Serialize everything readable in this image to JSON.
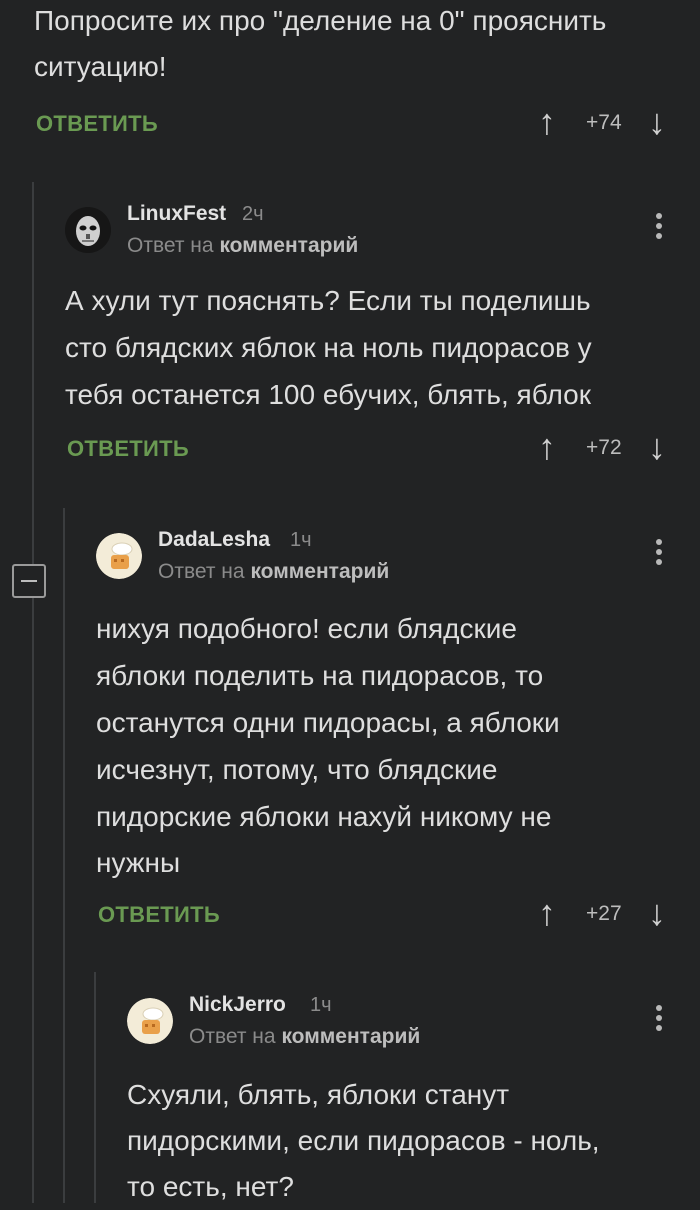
{
  "comment0": {
    "text_line1": "Попросите их про \"деление на 0\" прояснить",
    "text_line2": "ситуацию!",
    "reply_label": "ОТВЕТИТЬ",
    "rating": "+74"
  },
  "comment1": {
    "username": "LinuxFest",
    "time": "2ч",
    "answer_prefix": "Ответ на",
    "answer_target": "комментарий",
    "text_line1": "А хули тут пояснять? Если ты поделишь",
    "text_line2": "сто блядских яблок на ноль пидорасов у",
    "text_line3": "тебя останется 100 ебучих, блять, яблок",
    "reply_label": "ОТВЕТИТЬ",
    "rating": "+72"
  },
  "comment2": {
    "username": "DadaLesha",
    "time": "1ч",
    "answer_prefix": "Ответ на",
    "answer_target": "комментарий",
    "text_line1": "нихуя подобного! если блядские",
    "text_line2": "яблоки поделить на пидорасов, то",
    "text_line3": "останутся одни пидорасы, а яблоки",
    "text_line4": "исчезнут, потому, что блядские",
    "text_line5": "пидорские яблоки нахуй никому не",
    "text_line6": "нужны",
    "reply_label": "ОТВЕТИТЬ",
    "rating": "+27"
  },
  "comment3": {
    "username": "NickJerro",
    "time": "1ч",
    "answer_prefix": "Ответ на",
    "answer_target": "комментарий",
    "text_line1": "Схуяли, блять, яблоки станут",
    "text_line2": "пидорскими, если пидорасов - ноль,",
    "text_line3": "то есть, нет?"
  },
  "icons": {
    "upvote": "↑",
    "downvote": "↓"
  },
  "colors": {
    "background": "#222324",
    "reply_green": "#6a9a52",
    "thread_line": "#3b3d3f"
  }
}
